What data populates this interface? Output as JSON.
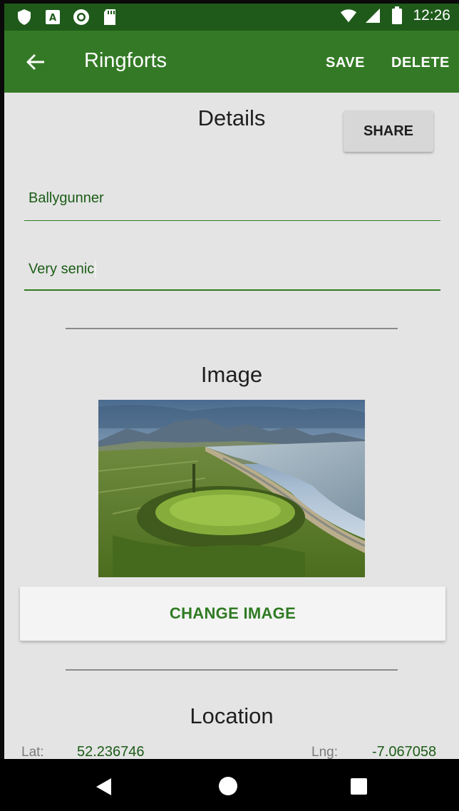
{
  "status_bar": {
    "time": "12:26",
    "left_icons": [
      "shield-icon",
      "text-app-icon",
      "circle-record-icon",
      "sd-card-icon"
    ],
    "right_icons": [
      "wifi-icon",
      "cell-signal-icon",
      "battery-icon"
    ]
  },
  "toolbar": {
    "title": "Ringforts",
    "save_label": "SAVE",
    "delete_label": "DELETE",
    "back_icon": "arrow-back-icon"
  },
  "details": {
    "title": "Details",
    "share_label": "SHARE",
    "name_value": "Ballygunner",
    "description_value": "Very senic"
  },
  "image_section": {
    "title": "Image",
    "change_label": "CHANGE IMAGE"
  },
  "location": {
    "title": "Location",
    "lat_label": "Lat:",
    "lat_value": "52.236746",
    "lng_label": "Lng:",
    "lng_value": "-7.067058"
  },
  "colors": {
    "status_bar": "#1f5a1a",
    "toolbar": "#347a26",
    "accent": "#2f7a23",
    "background": "#e4e4e4"
  },
  "nav_bar": {
    "icons": [
      "nav-back-icon",
      "nav-home-icon",
      "nav-recents-icon"
    ]
  }
}
